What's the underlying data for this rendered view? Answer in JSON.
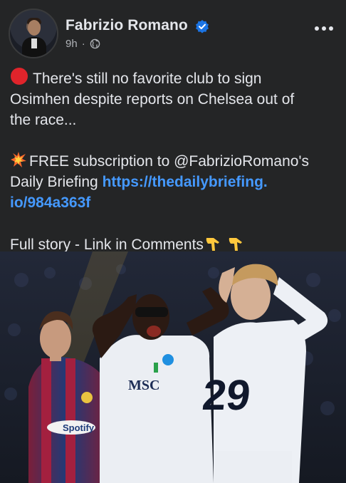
{
  "post": {
    "author": "Fabrizio Romano",
    "time": "9h",
    "visibility_icon": "globe-icon",
    "verified_icon": "verified-badge-icon",
    "line1": "There's still no favorite club to sign",
    "line2": "Osimhen despite reports on Chelsea out of",
    "line3": "the race...",
    "line4": "FREE subscription to @FabrizioRomano's",
    "line5_text": "Daily Briefing ",
    "line5_link": "https://thedailybriefing.",
    "line6_link": "io/984a363f",
    "line7": "Full story - Link in Comments"
  },
  "photo": {
    "jersey_number": "29",
    "sponsor_right": "MSC",
    "sponsor_left": "Spotify"
  },
  "colors": {
    "background": "#242526",
    "text": "#e4e6eb",
    "muted": "#b0b3b8",
    "link": "#4599ff",
    "verified": "#1b74e4"
  }
}
